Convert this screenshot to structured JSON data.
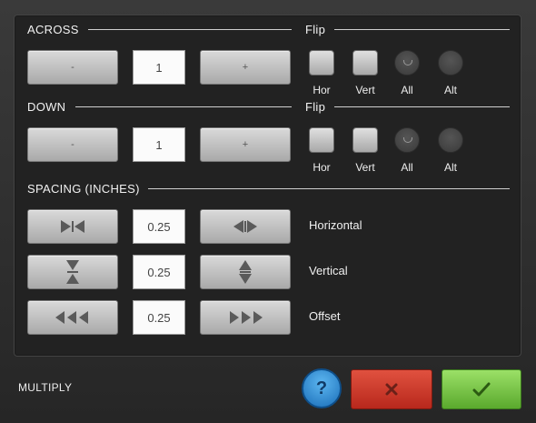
{
  "across": {
    "title": "ACROSS",
    "minus_label": "-",
    "value": "1",
    "plus_label": "+"
  },
  "down": {
    "title": "DOWN",
    "minus_label": "-",
    "value": "1",
    "plus_label": "+"
  },
  "flip": {
    "title": "Flip",
    "options": [
      "Hor",
      "Vert",
      "All",
      "Alt"
    ]
  },
  "spacing": {
    "title": "SPACING (INCHES)",
    "rows": [
      {
        "label": "Horizontal",
        "value": "0.25",
        "decrease_icon": "arrows-inward-horizontal-icon",
        "increase_icon": "arrows-outward-horizontal-icon"
      },
      {
        "label": "Vertical",
        "value": "0.25",
        "decrease_icon": "arrows-inward-vertical-icon",
        "increase_icon": "arrows-outward-vertical-icon"
      },
      {
        "label": "Offset",
        "value": "0.25",
        "decrease_icon": "triple-arrow-left-icon",
        "increase_icon": "triple-arrow-right-icon"
      }
    ]
  },
  "footer": {
    "title": "MULTIPLY",
    "help_label": "?"
  },
  "colors": {
    "cancel": "#c63a2b",
    "confirm": "#7cc64a",
    "help": "#2b8ad6"
  }
}
